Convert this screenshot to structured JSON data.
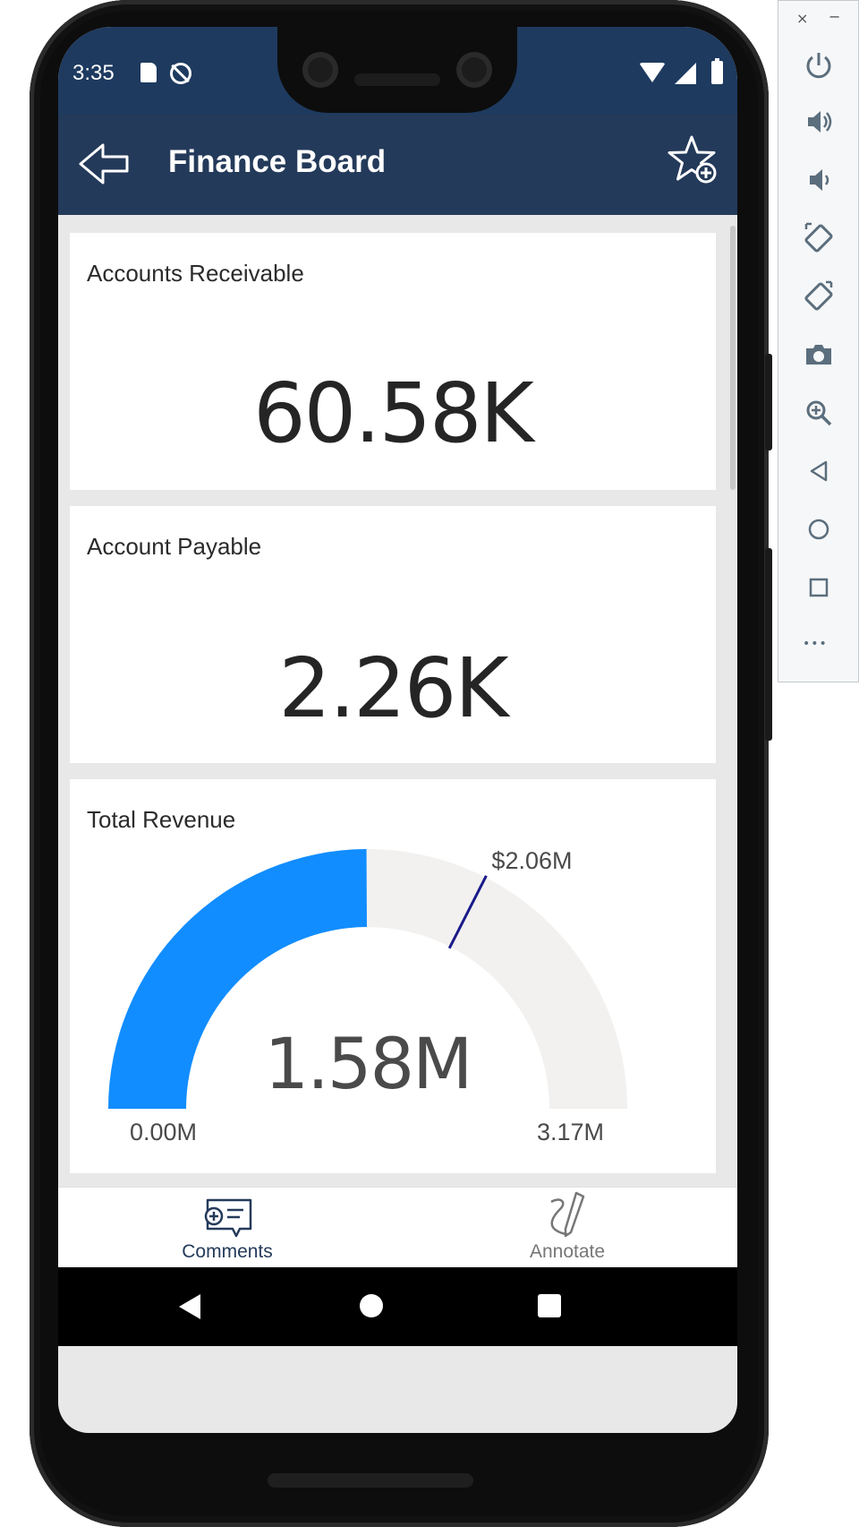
{
  "status_bar": {
    "time": "3:35"
  },
  "app_bar": {
    "title": "Finance Board"
  },
  "cards": [
    {
      "title": "Accounts Receivable",
      "value": "60.58K"
    },
    {
      "title": "Account Payable",
      "value": "2.26K"
    }
  ],
  "gauge_card": {
    "title": "Total Revenue",
    "value_label": "1.58M",
    "min_label": "0.00M",
    "max_label": "3.17M",
    "target_label": "$2.06M",
    "min": 0.0,
    "max": 3.17,
    "value": 1.58,
    "target": 2.06,
    "colors": {
      "fill": "#118dff",
      "track": "#f2f1f0",
      "target": "#1a1a8a",
      "text": "#4a4a4a"
    }
  },
  "bottom_bar": {
    "comments_label": "Comments",
    "annotate_label": "Annotate"
  },
  "colors": {
    "header": "#243a5a",
    "statusbar": "#1e3a5f",
    "comments_active": "#243a5a",
    "annotate_inactive": "#777777"
  },
  "emulator_panel": {
    "close_glyph": "×",
    "minimize_glyph": "−",
    "more_glyph": "•••"
  }
}
